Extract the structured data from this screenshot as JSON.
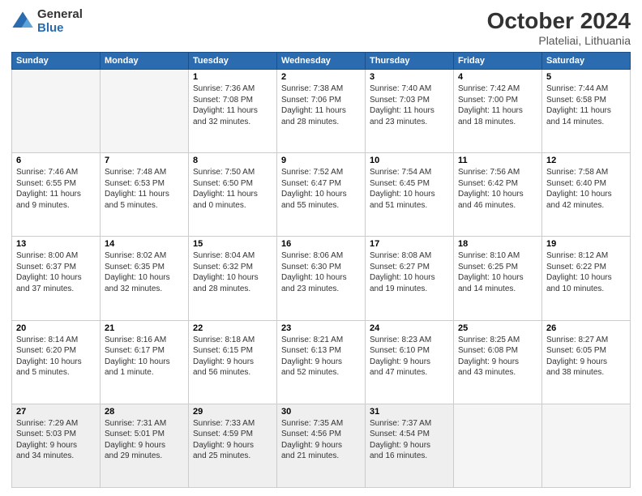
{
  "logo": {
    "general": "General",
    "blue": "Blue"
  },
  "header": {
    "title": "October 2024",
    "subtitle": "Plateliai, Lithuania"
  },
  "weekdays": [
    "Sunday",
    "Monday",
    "Tuesday",
    "Wednesday",
    "Thursday",
    "Friday",
    "Saturday"
  ],
  "weeks": [
    [
      {
        "day": "",
        "info": ""
      },
      {
        "day": "",
        "info": ""
      },
      {
        "day": "1",
        "info": "Sunrise: 7:36 AM\nSunset: 7:08 PM\nDaylight: 11 hours\nand 32 minutes."
      },
      {
        "day": "2",
        "info": "Sunrise: 7:38 AM\nSunset: 7:06 PM\nDaylight: 11 hours\nand 28 minutes."
      },
      {
        "day": "3",
        "info": "Sunrise: 7:40 AM\nSunset: 7:03 PM\nDaylight: 11 hours\nand 23 minutes."
      },
      {
        "day": "4",
        "info": "Sunrise: 7:42 AM\nSunset: 7:00 PM\nDaylight: 11 hours\nand 18 minutes."
      },
      {
        "day": "5",
        "info": "Sunrise: 7:44 AM\nSunset: 6:58 PM\nDaylight: 11 hours\nand 14 minutes."
      }
    ],
    [
      {
        "day": "6",
        "info": "Sunrise: 7:46 AM\nSunset: 6:55 PM\nDaylight: 11 hours\nand 9 minutes."
      },
      {
        "day": "7",
        "info": "Sunrise: 7:48 AM\nSunset: 6:53 PM\nDaylight: 11 hours\nand 5 minutes."
      },
      {
        "day": "8",
        "info": "Sunrise: 7:50 AM\nSunset: 6:50 PM\nDaylight: 11 hours\nand 0 minutes."
      },
      {
        "day": "9",
        "info": "Sunrise: 7:52 AM\nSunset: 6:47 PM\nDaylight: 10 hours\nand 55 minutes."
      },
      {
        "day": "10",
        "info": "Sunrise: 7:54 AM\nSunset: 6:45 PM\nDaylight: 10 hours\nand 51 minutes."
      },
      {
        "day": "11",
        "info": "Sunrise: 7:56 AM\nSunset: 6:42 PM\nDaylight: 10 hours\nand 46 minutes."
      },
      {
        "day": "12",
        "info": "Sunrise: 7:58 AM\nSunset: 6:40 PM\nDaylight: 10 hours\nand 42 minutes."
      }
    ],
    [
      {
        "day": "13",
        "info": "Sunrise: 8:00 AM\nSunset: 6:37 PM\nDaylight: 10 hours\nand 37 minutes."
      },
      {
        "day": "14",
        "info": "Sunrise: 8:02 AM\nSunset: 6:35 PM\nDaylight: 10 hours\nand 32 minutes."
      },
      {
        "day": "15",
        "info": "Sunrise: 8:04 AM\nSunset: 6:32 PM\nDaylight: 10 hours\nand 28 minutes."
      },
      {
        "day": "16",
        "info": "Sunrise: 8:06 AM\nSunset: 6:30 PM\nDaylight: 10 hours\nand 23 minutes."
      },
      {
        "day": "17",
        "info": "Sunrise: 8:08 AM\nSunset: 6:27 PM\nDaylight: 10 hours\nand 19 minutes."
      },
      {
        "day": "18",
        "info": "Sunrise: 8:10 AM\nSunset: 6:25 PM\nDaylight: 10 hours\nand 14 minutes."
      },
      {
        "day": "19",
        "info": "Sunrise: 8:12 AM\nSunset: 6:22 PM\nDaylight: 10 hours\nand 10 minutes."
      }
    ],
    [
      {
        "day": "20",
        "info": "Sunrise: 8:14 AM\nSunset: 6:20 PM\nDaylight: 10 hours\nand 5 minutes."
      },
      {
        "day": "21",
        "info": "Sunrise: 8:16 AM\nSunset: 6:17 PM\nDaylight: 10 hours\nand 1 minute."
      },
      {
        "day": "22",
        "info": "Sunrise: 8:18 AM\nSunset: 6:15 PM\nDaylight: 9 hours\nand 56 minutes."
      },
      {
        "day": "23",
        "info": "Sunrise: 8:21 AM\nSunset: 6:13 PM\nDaylight: 9 hours\nand 52 minutes."
      },
      {
        "day": "24",
        "info": "Sunrise: 8:23 AM\nSunset: 6:10 PM\nDaylight: 9 hours\nand 47 minutes."
      },
      {
        "day": "25",
        "info": "Sunrise: 8:25 AM\nSunset: 6:08 PM\nDaylight: 9 hours\nand 43 minutes."
      },
      {
        "day": "26",
        "info": "Sunrise: 8:27 AM\nSunset: 6:05 PM\nDaylight: 9 hours\nand 38 minutes."
      }
    ],
    [
      {
        "day": "27",
        "info": "Sunrise: 7:29 AM\nSunset: 5:03 PM\nDaylight: 9 hours\nand 34 minutes."
      },
      {
        "day": "28",
        "info": "Sunrise: 7:31 AM\nSunset: 5:01 PM\nDaylight: 9 hours\nand 29 minutes."
      },
      {
        "day": "29",
        "info": "Sunrise: 7:33 AM\nSunset: 4:59 PM\nDaylight: 9 hours\nand 25 minutes."
      },
      {
        "day": "30",
        "info": "Sunrise: 7:35 AM\nSunset: 4:56 PM\nDaylight: 9 hours\nand 21 minutes."
      },
      {
        "day": "31",
        "info": "Sunrise: 7:37 AM\nSunset: 4:54 PM\nDaylight: 9 hours\nand 16 minutes."
      },
      {
        "day": "",
        "info": ""
      },
      {
        "day": "",
        "info": ""
      }
    ]
  ]
}
